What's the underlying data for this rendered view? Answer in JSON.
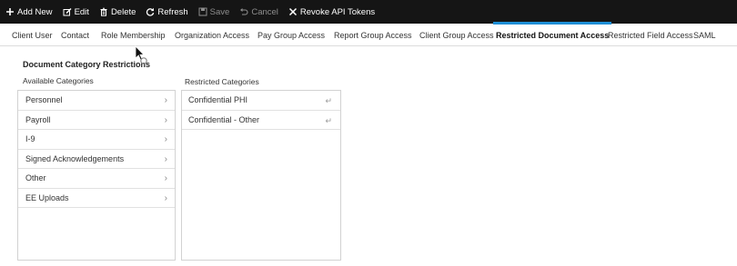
{
  "toolbar": {
    "add_new": "Add New",
    "edit": "Edit",
    "delete": "Delete",
    "refresh": "Refresh",
    "save": "Save",
    "cancel": "Cancel",
    "revoke": "Revoke API Tokens"
  },
  "tabs": [
    "Client User",
    "Contact",
    "Role Membership",
    "Organization Access",
    "Pay Group Access",
    "Report Group Access",
    "Client Group Access",
    "Restricted Document Access",
    "Restricted Field Access",
    "SAML"
  ],
  "active_tab": "Restricted Document Access",
  "section": {
    "title": "Document Category Restrictions"
  },
  "available": {
    "label": "Available Categories",
    "items": [
      "Personnel",
      "Payroll",
      "I-9",
      "Signed Acknowledgements",
      "Other",
      "EE Uploads"
    ]
  },
  "restricted": {
    "label": "Restricted Categories",
    "items": [
      "Confidential PHI",
      "Confidential - Other"
    ]
  },
  "colors": {
    "toolbar_bg": "#151515",
    "active_tab_accent": "#1f8fd6"
  },
  "icons": [
    "plus-icon",
    "edit-icon",
    "trash-icon",
    "refresh-icon",
    "save-icon",
    "undo-icon",
    "unlink-icon",
    "chevron-right-icon",
    "return-icon"
  ]
}
